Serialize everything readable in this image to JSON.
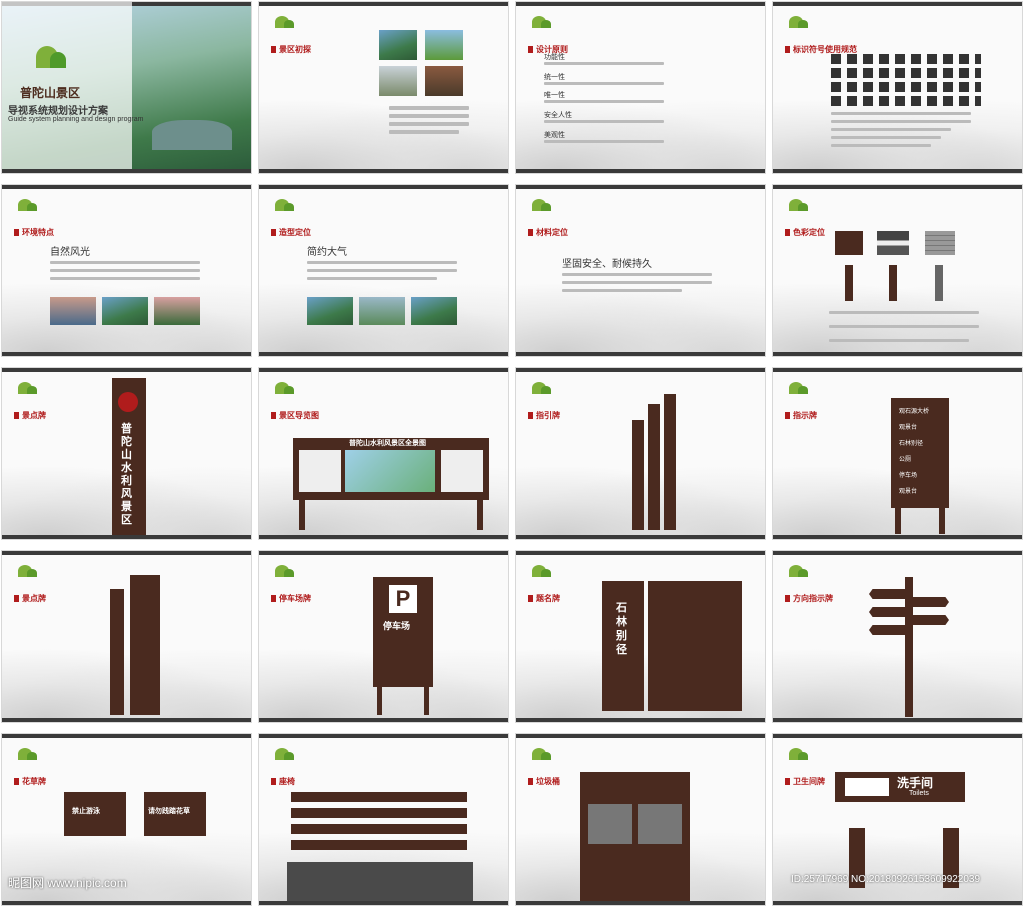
{
  "colors": {
    "wood": "#4a2a1f",
    "accent": "#b01c1c",
    "logo_green": "#7fb03a"
  },
  "cover": {
    "logo": "普陀山景区",
    "title": "导视系统规划设计方案",
    "subtitle": "Guide system planning and design program"
  },
  "slides": [
    {
      "tag": "景区初探"
    },
    {
      "tag": "设计原则",
      "items": [
        "功能性",
        "统一性",
        "唯一性",
        "安全人性",
        "美观性"
      ]
    },
    {
      "tag": "标识符号使用规范"
    },
    {
      "tag": "环境特点",
      "heading": "自然风光"
    },
    {
      "tag": "造型定位",
      "heading": "简约大气"
    },
    {
      "tag": "材料定位",
      "heading": "坚固安全、耐候持久"
    },
    {
      "tag": "色彩定位"
    },
    {
      "tag": "景点牌",
      "sign_text": "普陀山水利风景区"
    },
    {
      "tag": "景区导览图",
      "board_title": "普陀山水利风景区全景图"
    },
    {
      "tag": "指引牌"
    },
    {
      "tag": "指示牌",
      "rows": [
        "观石源大桥",
        "观景台",
        "石林别径",
        "公厕",
        "停车场",
        "观景台"
      ]
    },
    {
      "tag": "景点牌"
    },
    {
      "tag": "停车场牌",
      "sign_text": "停车场"
    },
    {
      "tag": "题名牌",
      "sign_text": "石林别径"
    },
    {
      "tag": "方向指示牌"
    },
    {
      "tag": "花草牌",
      "signs": [
        "禁止游泳",
        "请勿践踏花草"
      ]
    },
    {
      "tag": "座椅"
    },
    {
      "tag": "垃圾桶"
    },
    {
      "tag": "卫生间牌",
      "sign_text": "洗手间",
      "sign_sub": "Toilets"
    }
  ],
  "watermark": {
    "left": "昵图网 www.nipic.com",
    "right": "ID:25717969 NO:20180926153609922039"
  }
}
